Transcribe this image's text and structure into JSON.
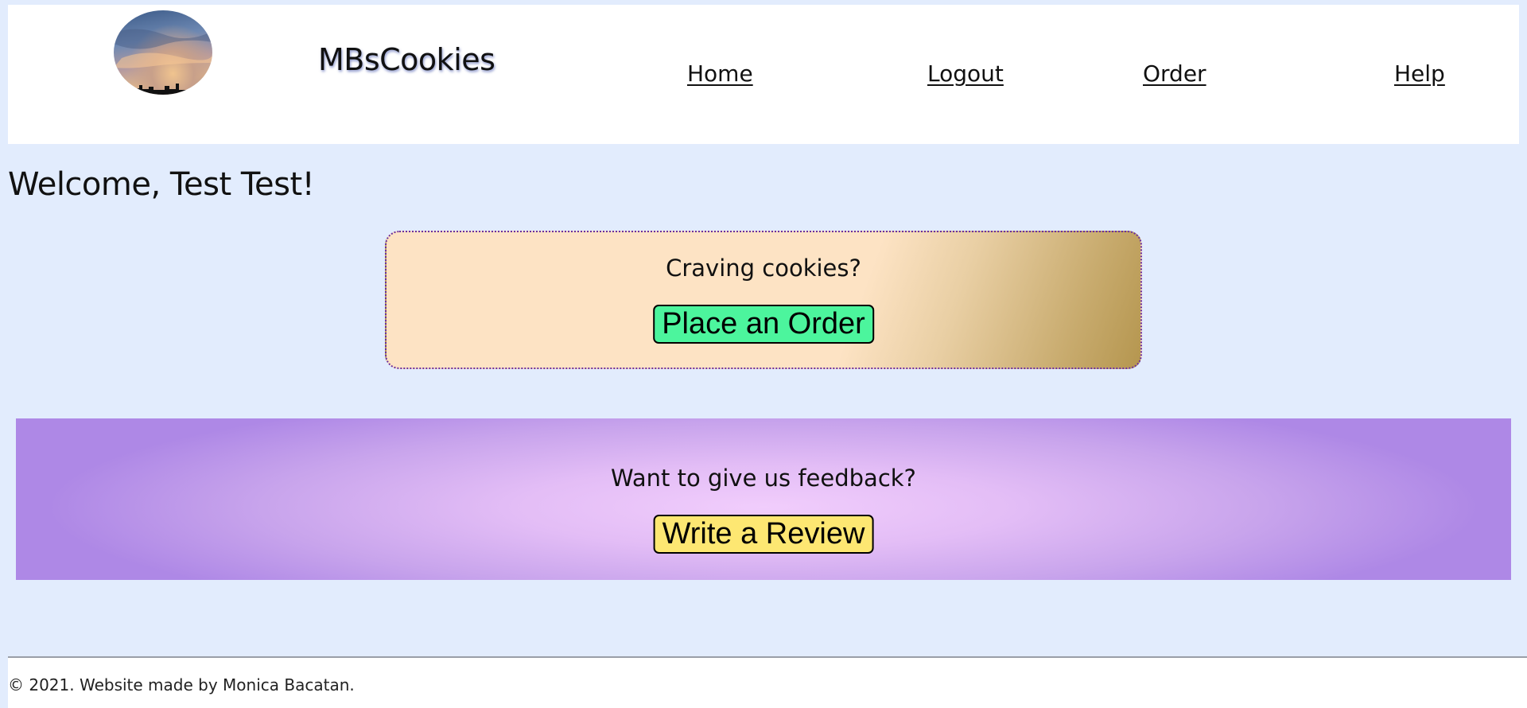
{
  "header": {
    "logo_icon": "sunset-sky-logo-icon",
    "brand": "MBsCookies",
    "nav": {
      "home": "Home",
      "logout": "Logout",
      "order": "Order",
      "help": "Help"
    }
  },
  "main": {
    "welcome": "Welcome, Test Test!",
    "order_card": {
      "prompt": "Craving cookies?",
      "button": "Place an Order"
    },
    "review_section": {
      "prompt": "Want to give us feedback?",
      "button": "Write a Review"
    }
  },
  "footer": {
    "copyright": "© 2021. Website made by Monica Bacatan."
  },
  "colors": {
    "page_background": "#e2ecfd",
    "order_button": "#4cf59d",
    "review_button": "#fde772",
    "order_card_border": "#6a2fa0"
  }
}
